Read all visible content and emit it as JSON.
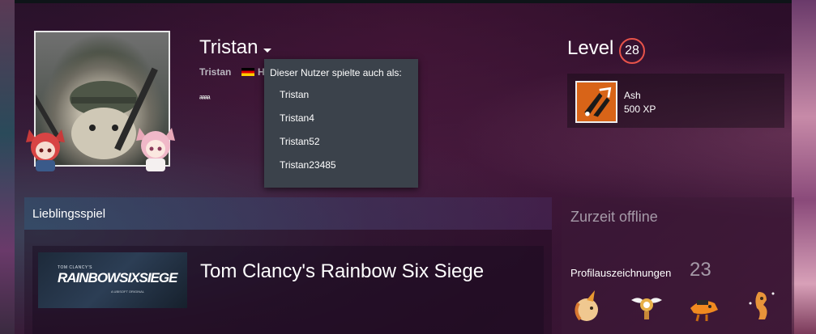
{
  "profile": {
    "persona_name": "Tristan",
    "real_name": "Tristan",
    "location": "H",
    "summary": "ᵃᵃᵃᵃ"
  },
  "alias_popup": {
    "title": "Dieser Nutzer spielte auch als:",
    "aliases": [
      "Tristan",
      "Tristan4",
      "Tristan52",
      "Tristan23485"
    ]
  },
  "level": {
    "label": "Level",
    "value": "28",
    "color": "#e8534a"
  },
  "badge": {
    "name": "Ash",
    "xp": "500 XP",
    "icon": "rainbow-six-ash-icon"
  },
  "favorite_game": {
    "section_label": "Lieblingsspiel",
    "title": "Tom Clancy's Rainbow Six Siege",
    "capsule_top": "TOM CLANCY'S",
    "capsule_main": "RAINBOWSIXSIEGE",
    "capsule_sub": "A UBISOFT ORIGINAL"
  },
  "status": {
    "text": "Zurzeit offline"
  },
  "awards": {
    "label": "Profilauszeichnungen",
    "count": "23",
    "icons": [
      "unicorn-award-icon",
      "winged-award-icon",
      "dino-award-icon",
      "creature-award-icon"
    ]
  }
}
